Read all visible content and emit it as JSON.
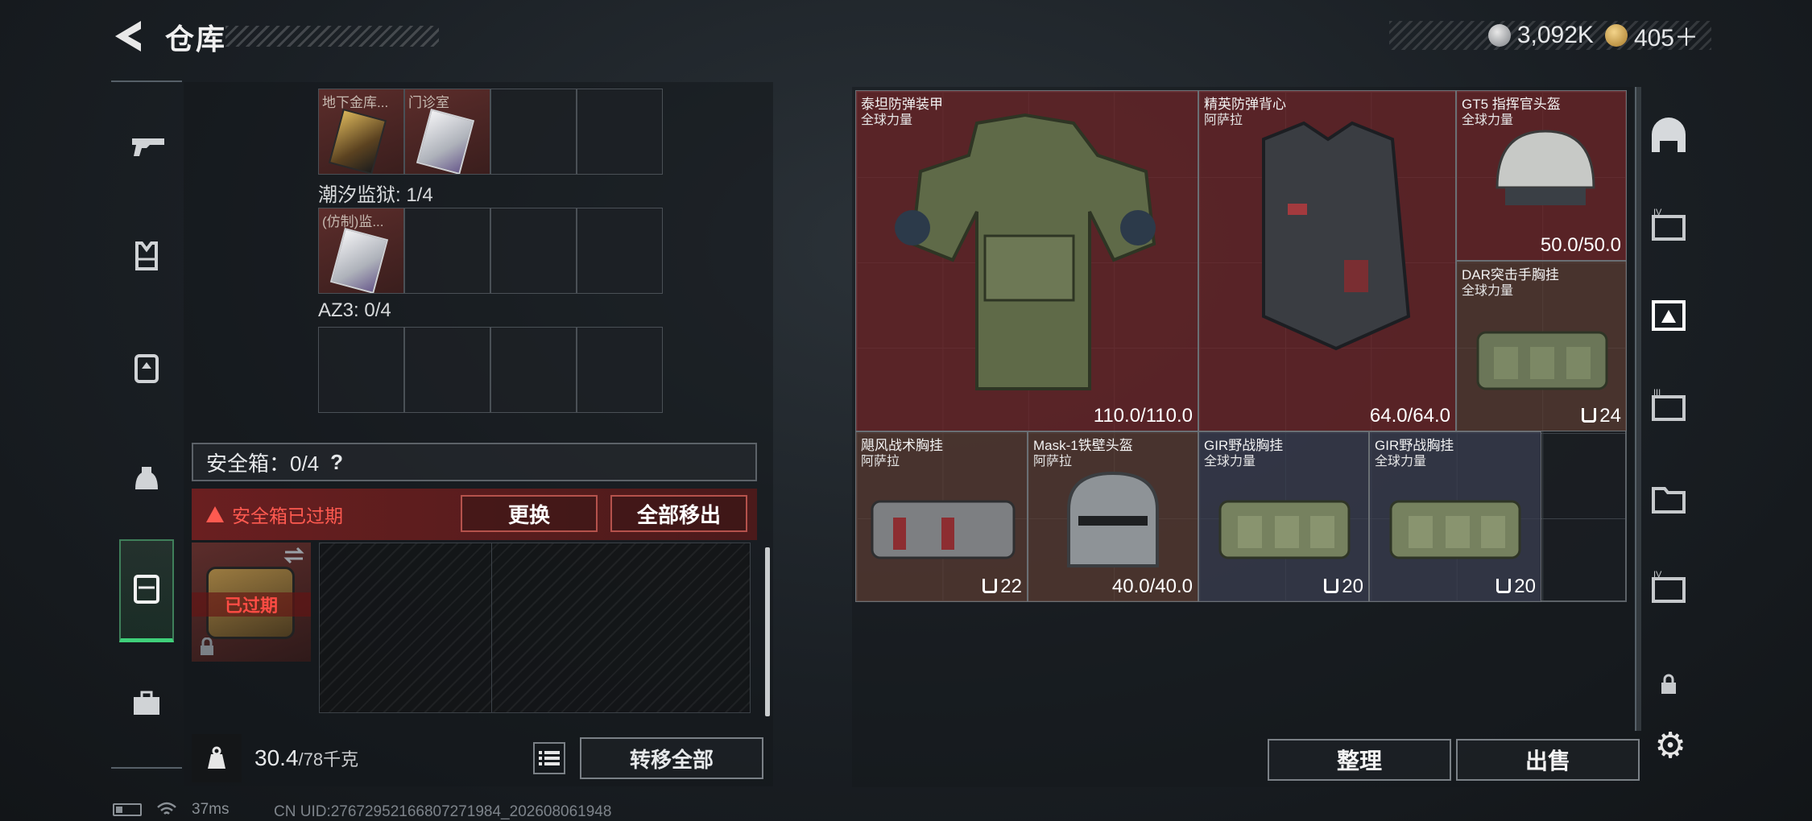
{
  "header": {
    "title": "仓库",
    "currency_silver": "3,092K",
    "currency_gold": "405＋"
  },
  "left_rail": [
    "gun-icon",
    "vest-icon",
    "backpack-icon",
    "helmet-icon",
    "safebox-icon",
    "briefcase-icon"
  ],
  "inventory": {
    "top_slots": [
      {
        "label": "地下金库...",
        "filled": true,
        "art": "gold-card"
      },
      {
        "label": "门诊室",
        "filled": true,
        "art": "white-card"
      },
      {
        "label": "",
        "filled": false
      },
      {
        "label": "",
        "filled": false
      }
    ],
    "prison_label": "潮汐监狱: 1/4",
    "prison_slots": [
      {
        "label": "(仿制)监...",
        "filled": true,
        "art": "white-card"
      },
      {
        "label": "",
        "filled": false
      },
      {
        "label": "",
        "filled": false
      },
      {
        "label": "",
        "filled": false
      }
    ],
    "az3_label": "AZ3: 0/4"
  },
  "safebox": {
    "label": "安全箱：0/4",
    "help": "?",
    "expired_text": "安全箱已过期",
    "replace_label": "更换",
    "remove_all_label": "全部移出",
    "item_expired_label": "已过期"
  },
  "weight": {
    "current": "30.4",
    "max": "/78千克",
    "transfer_all_label": "转移全部"
  },
  "items": [
    {
      "name": "泰坦防弹装甲",
      "origin": "全球力量",
      "value": "110.0/110.0",
      "color": "red"
    },
    {
      "name": "精英防弹背心",
      "origin": "阿萨拉",
      "value": "64.0/64.0",
      "color": "red"
    },
    {
      "name": "GT5 指挥官头盔",
      "origin": "全球力量",
      "value": "50.0/50.0",
      "color": "red"
    },
    {
      "name": "DAR突击手胸挂",
      "origin": "全球力量",
      "value": "24",
      "color": "brown"
    },
    {
      "name": "飓风战术胸挂",
      "origin": "阿萨拉",
      "value": "22",
      "color": "brown"
    },
    {
      "name": "Mask-1铁壁头盔",
      "origin": "阿萨拉",
      "value": "40.0/40.0",
      "color": "brown"
    },
    {
      "name": "GIR野战胸挂",
      "origin": "全球力量",
      "value": "20",
      "color": "blue"
    },
    {
      "name": "GIR野战胸挂",
      "origin": "全球力量",
      "value": "20",
      "color": "blue"
    }
  ],
  "actions": {
    "organize_label": "整理",
    "sell_label": "出售"
  },
  "status": {
    "ping": "37ms",
    "uid": "CN UID:276729521668072719​84_202608061948"
  },
  "colors": {
    "item_red": "#6e2628",
    "item_brown": "#5a3c32",
    "item_blue": "#383c4e",
    "alert_red": "#ff5a50",
    "active_green": "#3fd07a"
  }
}
